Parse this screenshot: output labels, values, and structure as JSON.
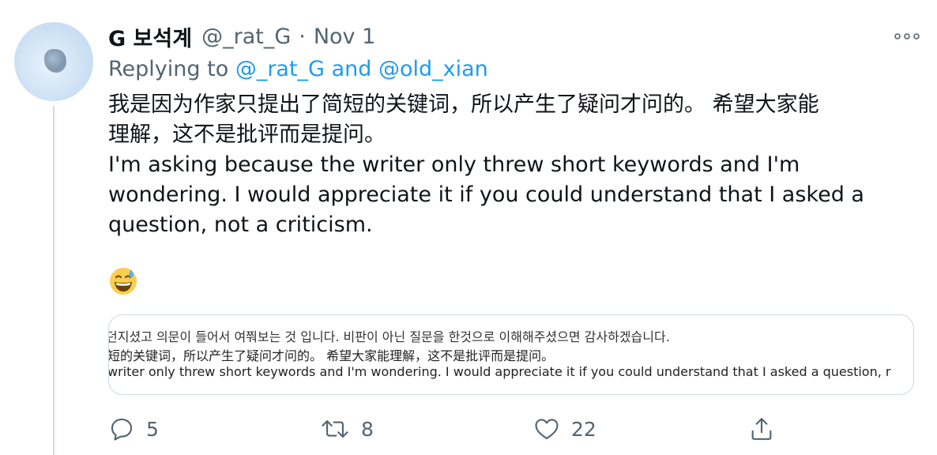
{
  "tweet": {
    "author": {
      "display_name": "G 보석계",
      "handle": "@_rat_G",
      "separator": "·",
      "date": "Nov 1"
    },
    "replying": {
      "prefix": "Replying to",
      "mention1": "@_rat_G",
      "conj": "and",
      "mention2": "@old_xian"
    },
    "body": {
      "zh_line1": "我是因为作家只提出了简短的关键词，所以产生了疑问才问的。 希望大家能",
      "zh_line2": "理解，这不是批评而是提问。",
      "en_line1": "I'm asking because the writer only threw short keywords and I'm",
      "en_line2": "wondering. I would appreciate it if you could understand that I asked a",
      "en_line3": "question, not a criticism."
    },
    "emoji_name": "grinning-face-with-sweat",
    "media": {
      "line1": "던지셨고 의문이 들어서 여쭤보는 것 입니다. 비판이 아닌 질문을 한것으로 이해해주셨으면 감사하겠습니다.",
      "line2": "短的关键词，所以产生了疑问才问的。 希望大家能理解，这不是批评而是提问。",
      "line3": "writer only threw short keywords and I'm wondering. I would appreciate it if you could understand that I asked a question, r"
    },
    "actions": {
      "reply_count": "5",
      "retweet_count": "8",
      "like_count": "22"
    },
    "colors": {
      "link": "#1d9bf0",
      "secondary": "#536471",
      "text": "#0f1419",
      "border": "#cfd9de",
      "emoji_face": "#ffcc4d"
    },
    "icons": {
      "more": "more-dots-icon",
      "reply": "reply-bubble-icon",
      "retweet": "retweet-icon",
      "like": "heart-icon",
      "share": "share-icon"
    }
  }
}
